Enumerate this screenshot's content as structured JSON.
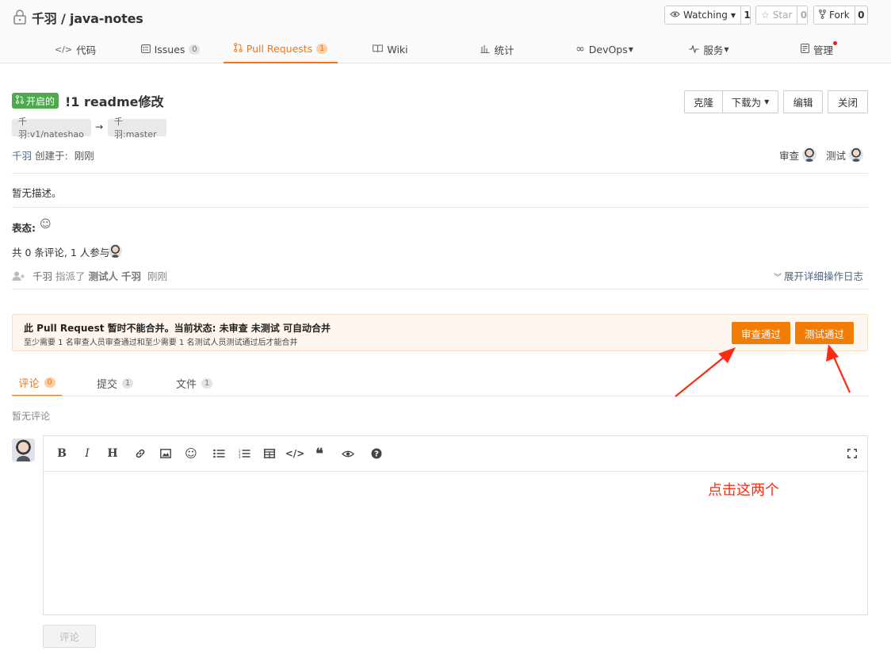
{
  "repo": {
    "title": "千羽 / java-notes"
  },
  "repo_actions": {
    "watching_label": "Watching",
    "watching_count": "1",
    "star_label": "Star",
    "star_count": "0",
    "fork_label": "Fork",
    "fork_count": "0"
  },
  "nav_tabs": [
    {
      "label": "代码"
    },
    {
      "label": "Issues",
      "count": "0"
    },
    {
      "label": "Pull Requests",
      "count": "1"
    },
    {
      "label": "Wiki"
    },
    {
      "label": "统计"
    },
    {
      "label": "DevOps"
    },
    {
      "label": "服务"
    },
    {
      "label": "管理"
    }
  ],
  "pr": {
    "status_label": "开启的",
    "title": "!1 readme修改",
    "source_branch": "千羽:v1/nateshao",
    "arrow": "→",
    "target_branch": "千羽:master",
    "author": "千羽",
    "created_label": "创建于:",
    "created_time": "刚刚",
    "reviewer_label": "审查",
    "tester_label": "测试",
    "description": "暂无描述。",
    "reaction_label": "表态:",
    "comment_summary": "共 0 条评论, 1 人参与",
    "activity": {
      "actor": "千羽",
      "action": "指派了",
      "role": "测试人",
      "target": "千羽",
      "time": "刚刚"
    },
    "expand_log_label": "展开详细操作日志"
  },
  "pr_actions": {
    "clone": "克隆",
    "download": "下载为",
    "edit": "编辑",
    "close": "关闭"
  },
  "merge_notice": {
    "title": "此 Pull Request 暂时不能合并。当前状态: 未审查 未测试 可自动合并",
    "subtitle": "至少需要 1 名审查人员审查通过和至少需要 1 名测试人员测试通过后才能合并",
    "review_pass_button": "审查通过",
    "test_pass_button": "测试通过"
  },
  "comment_tabs": [
    {
      "label": "评论",
      "count": "0"
    },
    {
      "label": "提交",
      "count": "1"
    },
    {
      "label": "文件",
      "count": "1"
    }
  ],
  "comments": {
    "empty_text": "暂无评论",
    "submit_label": "评论"
  },
  "annotation": {
    "text": "点击这两个",
    "color": "#ff2a12"
  },
  "colors": {
    "accent": "#f0741b",
    "open_badge": "#4caa4c",
    "action_button": "#f37c05",
    "link": "#4a6785"
  }
}
